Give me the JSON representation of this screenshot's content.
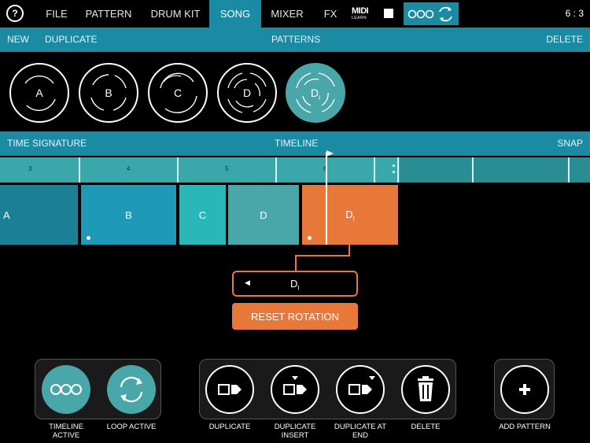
{
  "nav": {
    "help_label": "?",
    "tabs": [
      {
        "label": "FILE",
        "active": false
      },
      {
        "label": "PATTERN",
        "active": false
      },
      {
        "label": "DRUM KIT",
        "active": false
      },
      {
        "label": "SONG",
        "active": true
      },
      {
        "label": "MIXER",
        "active": false
      },
      {
        "label": "FX",
        "active": false
      }
    ],
    "midi_label_top": "MIDI",
    "midi_label_bottom": "LEARN",
    "time_sig": "6 : 3"
  },
  "patterns_bar": {
    "new": "NEW",
    "duplicate": "DUPLICATE",
    "title": "PATTERNS",
    "delete": "DELETE"
  },
  "patterns": [
    {
      "label": "A",
      "sub": ""
    },
    {
      "label": "B",
      "sub": ""
    },
    {
      "label": "C",
      "sub": ""
    },
    {
      "label": "D",
      "sub": ""
    },
    {
      "label": "D",
      "sub": "I",
      "selected": true
    }
  ],
  "timeline_bar": {
    "time_signature": "TIME SIGNATURE",
    "title": "TIMELINE",
    "snap": "SNAP"
  },
  "ruler": {
    "numbers": [
      "3",
      "4",
      "5",
      "6"
    ]
  },
  "timeline_blocks": [
    {
      "label": "A",
      "sub": "",
      "color": "#1b7f96"
    },
    {
      "label": "B",
      "sub": "",
      "color": "#1e9ab8"
    },
    {
      "label": "C",
      "sub": "",
      "color": "#2ab7b9"
    },
    {
      "label": "D",
      "sub": "",
      "color": "#4aa7a9"
    },
    {
      "label": "D",
      "sub": "I",
      "color": "#e8773a"
    }
  ],
  "selection": {
    "label": "D",
    "sub": "I",
    "arrow": "◀"
  },
  "reset_label": "RESET ROTATION",
  "controls": {
    "timeline_active": "TIMELINE ACTIVE",
    "loop_active": "LOOP ACTIVE",
    "duplicate": "DUPLICATE",
    "duplicate_insert": "DUPLICATE INSERT",
    "duplicate_at_end": "DUPLICATE AT END",
    "delete": "DELETE",
    "add_pattern": "ADD PATTERN"
  },
  "colors": {
    "accent": "#1b8aa3",
    "orange": "#e8773a",
    "teal": "#4aa7a9"
  }
}
